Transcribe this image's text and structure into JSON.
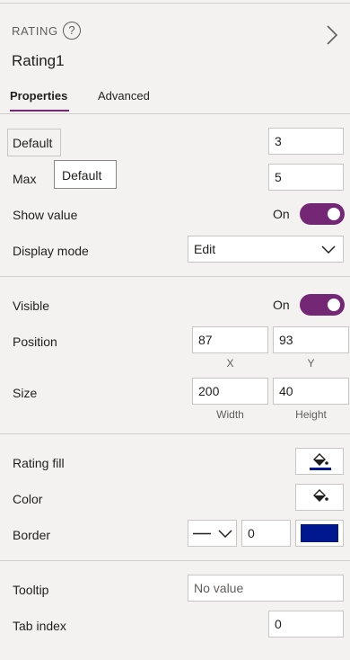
{
  "header": {
    "control_type": "RATING",
    "help_icon": "?",
    "control_name": "Rating1",
    "nav_icon": "chevron-right-icon"
  },
  "tabs": [
    {
      "label": "Properties",
      "active": true
    },
    {
      "label": "Advanced",
      "active": false
    }
  ],
  "properties": {
    "default": {
      "label": "Default",
      "value": "3"
    },
    "tooltip_popup": "Default",
    "max": {
      "label": "Max",
      "value": "5"
    },
    "show_value": {
      "label": "Show value",
      "state": "On",
      "on": true
    },
    "display_mode": {
      "label": "Display mode",
      "value": "Edit"
    },
    "visible": {
      "label": "Visible",
      "state": "On",
      "on": true
    },
    "position": {
      "label": "Position",
      "x": "87",
      "y": "93",
      "x_label": "X",
      "y_label": "Y"
    },
    "size": {
      "label": "Size",
      "width": "200",
      "height": "40",
      "width_label": "Width",
      "height_label": "Height"
    },
    "rating_fill": {
      "label": "Rating fill",
      "color": "#00188f"
    },
    "color": {
      "label": "Color",
      "color": "#ffffff"
    },
    "border": {
      "label": "Border",
      "style": "solid",
      "width": "0",
      "color": "#00188f"
    },
    "tooltip": {
      "label": "Tooltip",
      "placeholder": "No value"
    },
    "tab_index": {
      "label": "Tab index",
      "value": "0"
    }
  },
  "colors": {
    "accent": "#742774",
    "panel_bg": "#f3f2f1"
  }
}
